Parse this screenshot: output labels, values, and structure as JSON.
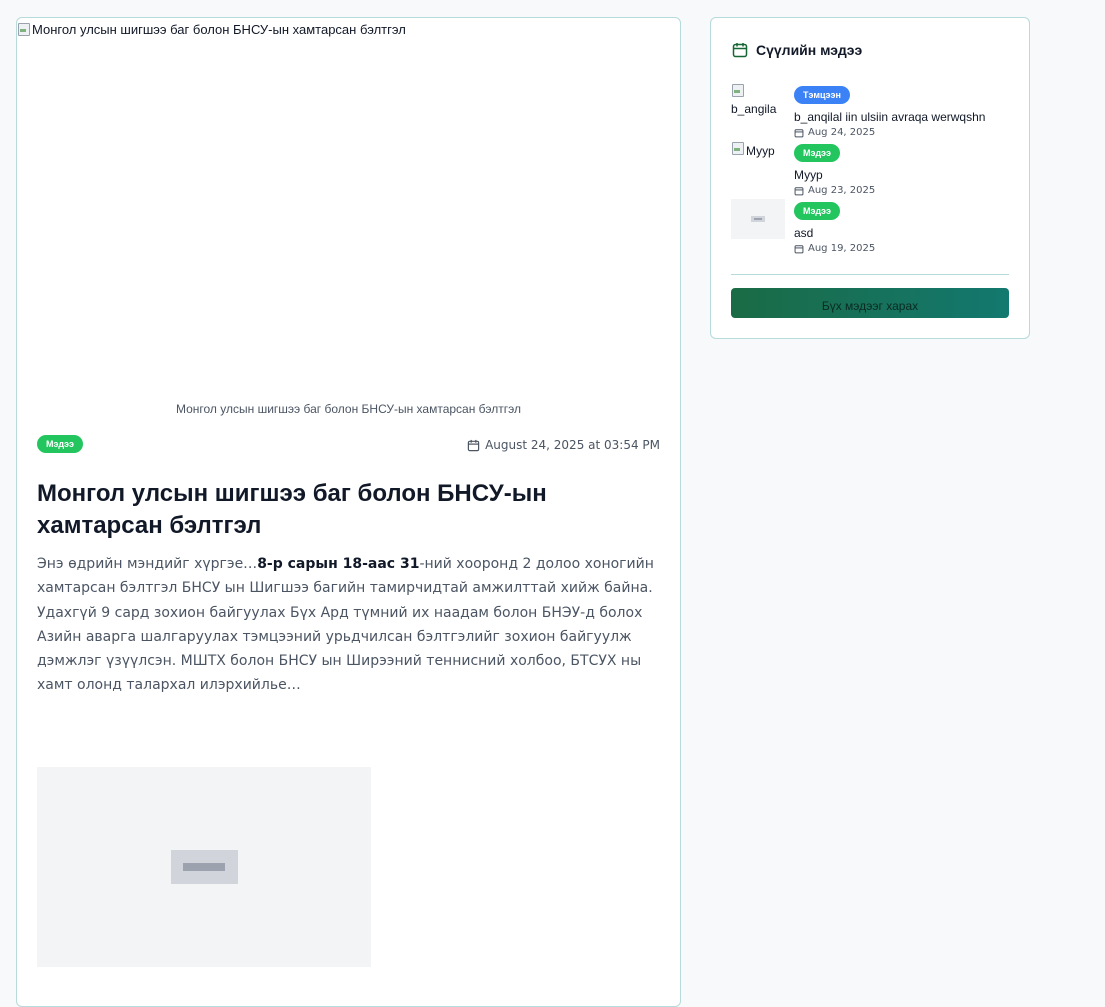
{
  "article": {
    "image_alt": "Монгол улсын шигшээ баг болон БНСУ-ын хамтарсан бэлтгэл",
    "caption": "Монгол улсын шигшээ баг болон БНСУ-ын хамтарсан бэлтгэл",
    "category": "Мэдээ",
    "date": "August 24, 2025 at 03:54 PM",
    "title": "Монгол улсын шигшээ баг болон БНСУ-ын хамтарсан бэлтгэл",
    "body_intro": "Энэ өдрийн мэндийг хүргэе…",
    "body_bold": "8-р сарын 18-аас 31",
    "body_rest": "-ний хооронд 2 долоо хоногийн хамтарсан бэлтгэл БНСУ ын Шигшээ багийн тамирчидтай амжилттай хийж байна. Удахгүй 9 сард зохион байгуулах Бүх Ард түмний их наадам болон БНЭУ-д болох Азийн аварга шалгаруулах тэмцээний урьдчилсан бэлтгэлийг зохион байгуулж дэмжлэг үзүүлсэн. МШТХ болон БНСУ ын Ширээний теннисний холбоо, БТСУХ ны хамт олонд талархал илэрхийлье…"
  },
  "sidebar": {
    "title": "Сүүлийн мэдээ",
    "items": [
      {
        "thumb_alt": "b_angila",
        "category": "Тэмцээн",
        "title": "b_anqilal iin ulsiin avraqa werwqshn",
        "date": "Aug 24, 2025"
      },
      {
        "thumb_alt": "Муур",
        "category": "Мэдээ",
        "title": "Муур",
        "date": "Aug 23, 2025"
      },
      {
        "thumb_alt": "",
        "category": "Мэдээ",
        "title": "asd",
        "date": "Aug 19, 2025"
      }
    ],
    "all_button": "Бүх мэдээг харах"
  },
  "colors": {
    "accent_green": "#22c55e",
    "accent_blue": "#3b82f6",
    "border": "#b7dada",
    "button_gradient_start": "#1a6b45",
    "button_gradient_end": "#13786f"
  },
  "icons": [
    "calendar-icon",
    "broken-image-icon",
    "image-placeholder-icon"
  ]
}
